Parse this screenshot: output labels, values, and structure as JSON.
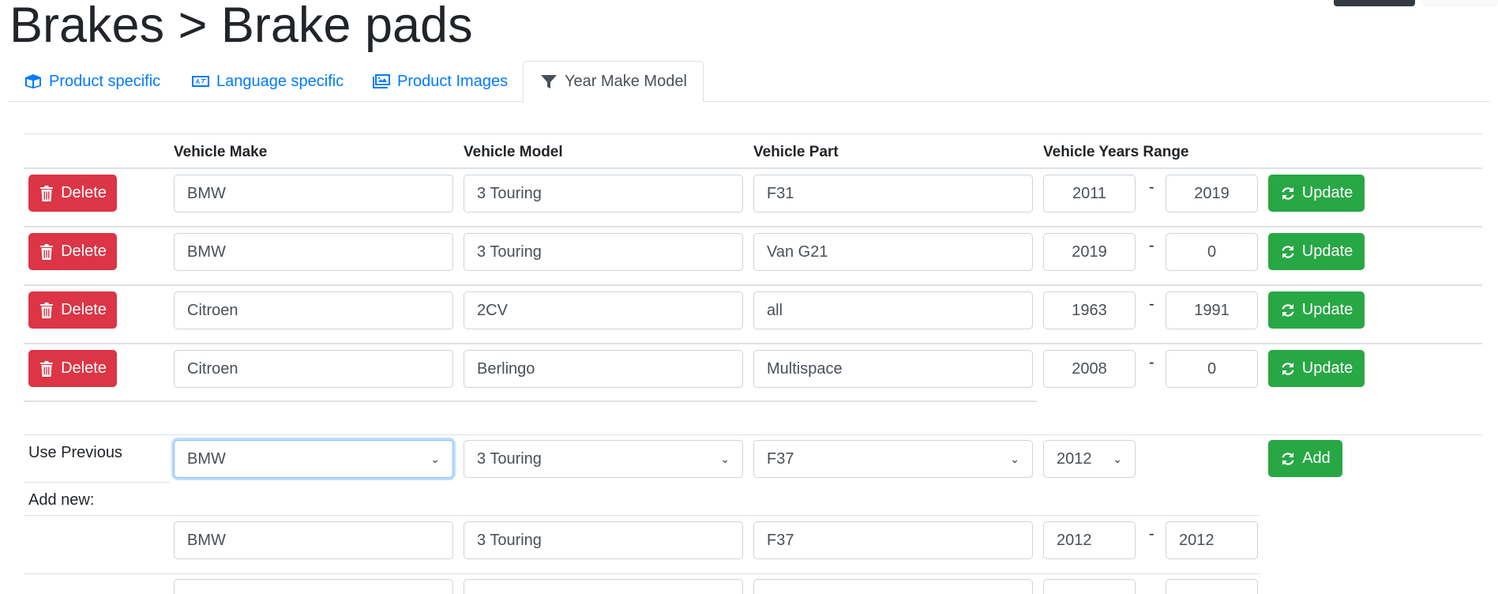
{
  "page": {
    "title": "Brakes > Brake pads"
  },
  "tabs": [
    {
      "label": "Product specific",
      "icon": "box-icon",
      "active": false
    },
    {
      "label": "Language specific",
      "icon": "language-icon",
      "active": false
    },
    {
      "label": "Product Images",
      "icon": "images-icon",
      "active": false
    },
    {
      "label": "Year Make Model",
      "icon": "filter-icon",
      "active": true
    }
  ],
  "table": {
    "headers": {
      "make": "Vehicle Make",
      "model": "Vehicle Model",
      "part": "Vehicle Part",
      "years": "Vehicle Years Range"
    },
    "delete_label": "Delete",
    "update_label": "Update",
    "year_separator": "-",
    "rows": [
      {
        "make": "BMW",
        "model": "3 Touring",
        "part": "F31",
        "year_from": "2011",
        "year_to": "2019"
      },
      {
        "make": "BMW",
        "model": "3 Touring",
        "part": "Van G21",
        "year_from": "2019",
        "year_to": "0"
      },
      {
        "make": "Citroen",
        "model": "2CV",
        "part": "all",
        "year_from": "1963",
        "year_to": "1991"
      },
      {
        "make": "Citroen",
        "model": "Berlingo",
        "part": "Multispace",
        "year_from": "2008",
        "year_to": "0"
      }
    ]
  },
  "use_previous": {
    "label": "Use Previous",
    "make": "BMW",
    "model": "3 Touring",
    "part": "F37",
    "year": "2012",
    "add_label": "Add"
  },
  "add_new": {
    "label": "Add new:",
    "make": "BMW",
    "model": "3 Touring",
    "part": "F37",
    "year_from": "2012",
    "year_to": "2012"
  },
  "colors": {
    "danger": "#dc3545",
    "success": "#28a745",
    "link": "#007bff"
  }
}
